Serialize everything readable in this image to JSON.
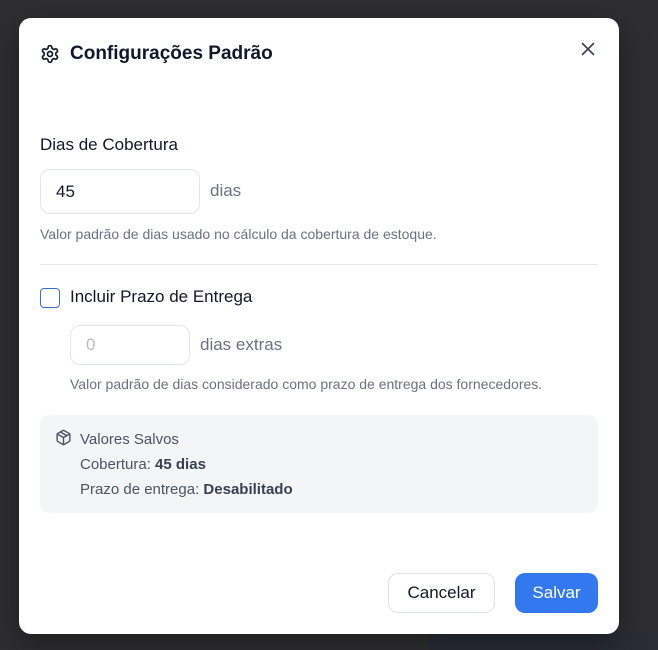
{
  "dialog": {
    "title": "Configurações Padrão",
    "title_icon": "gear-icon",
    "close_icon": "close-icon"
  },
  "coverage": {
    "label": "Dias de Cobertura",
    "value": "45",
    "unit": "dias",
    "help": "Valor padrão de dias usado no cálculo da cobertura de estoque."
  },
  "lead_time": {
    "checkbox_label": "Incluir Prazo de Entrega",
    "checked": false,
    "placeholder": "0",
    "unit": "dias extras",
    "help": "Valor padrão de dias considerado como prazo de entrega dos fornecedores."
  },
  "saved": {
    "title": "Valores Salvos",
    "icon": "package-icon",
    "coverage_label": "Cobertura:",
    "coverage_value": "45 dias",
    "lead_label": "Prazo de entrega:",
    "lead_value": "Desabilitado"
  },
  "footer": {
    "cancel_label": "Cancelar",
    "save_label": "Salvar"
  },
  "colors": {
    "primary": "#3478f0",
    "checkbox_border": "#3b6fd8",
    "panel_bg": "#f4f5f7"
  }
}
